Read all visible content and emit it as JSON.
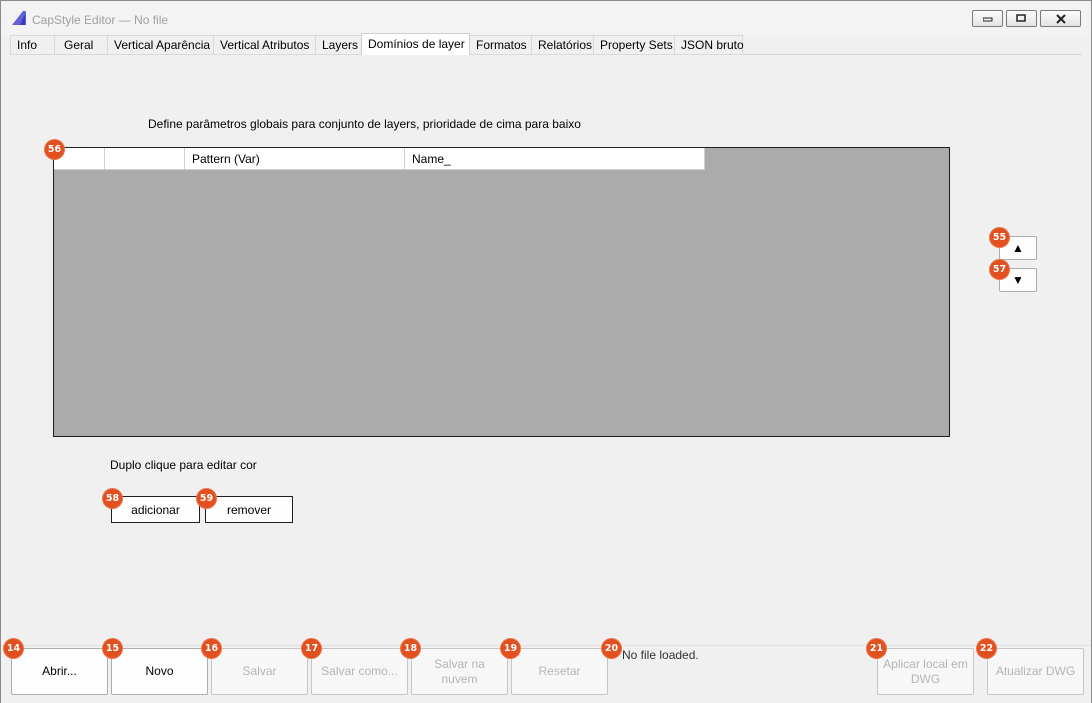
{
  "window": {
    "title": "CapStyle Editor — No file"
  },
  "tabs": [
    {
      "label": "Info"
    },
    {
      "label": "Geral"
    },
    {
      "label": "Vertical Aparência"
    },
    {
      "label": "Vertical Atributos"
    },
    {
      "label": "Layers"
    },
    {
      "label": "Domínios de layer"
    },
    {
      "label": "Formatos"
    },
    {
      "label": "Relatórios"
    },
    {
      "label": "Property Sets"
    },
    {
      "label": "JSON bruto"
    }
  ],
  "active_tab": "Domínios de layer",
  "panel": {
    "description": "Define parâmetros globais para conjunto de layers, prioridade de cima para baixo",
    "grid_columns": [
      "",
      "",
      "Pattern (Var)",
      "Name_"
    ],
    "move_up_label": "▲",
    "move_down_label": "▼",
    "hint": "Duplo clique para editar cor",
    "add_label": "adicionar",
    "remove_label": "remover"
  },
  "bottom": {
    "open_label": "Abrir...",
    "new_label": "Novo",
    "save_label": "Salvar",
    "save_as_label": "Salvar como...",
    "save_cloud_label": "Salvar na nuvem",
    "reset_label": "Resetar",
    "status": "No file loaded.",
    "apply_local_label": "Aplicar local em DWG",
    "update_dwg_label": "Atualizar DWG"
  },
  "badges": {
    "b14": "14",
    "b15": "15",
    "b16": "16",
    "b17": "17",
    "b18": "18",
    "b19": "19",
    "b20": "20",
    "b21": "21",
    "b22": "22",
    "b55": "55",
    "b56": "56",
    "b57": "57",
    "b58": "58",
    "b59": "59"
  },
  "colors": {
    "badge": "#e2501f",
    "grid_background": "#ababab",
    "logo": "#5b5bd6"
  }
}
